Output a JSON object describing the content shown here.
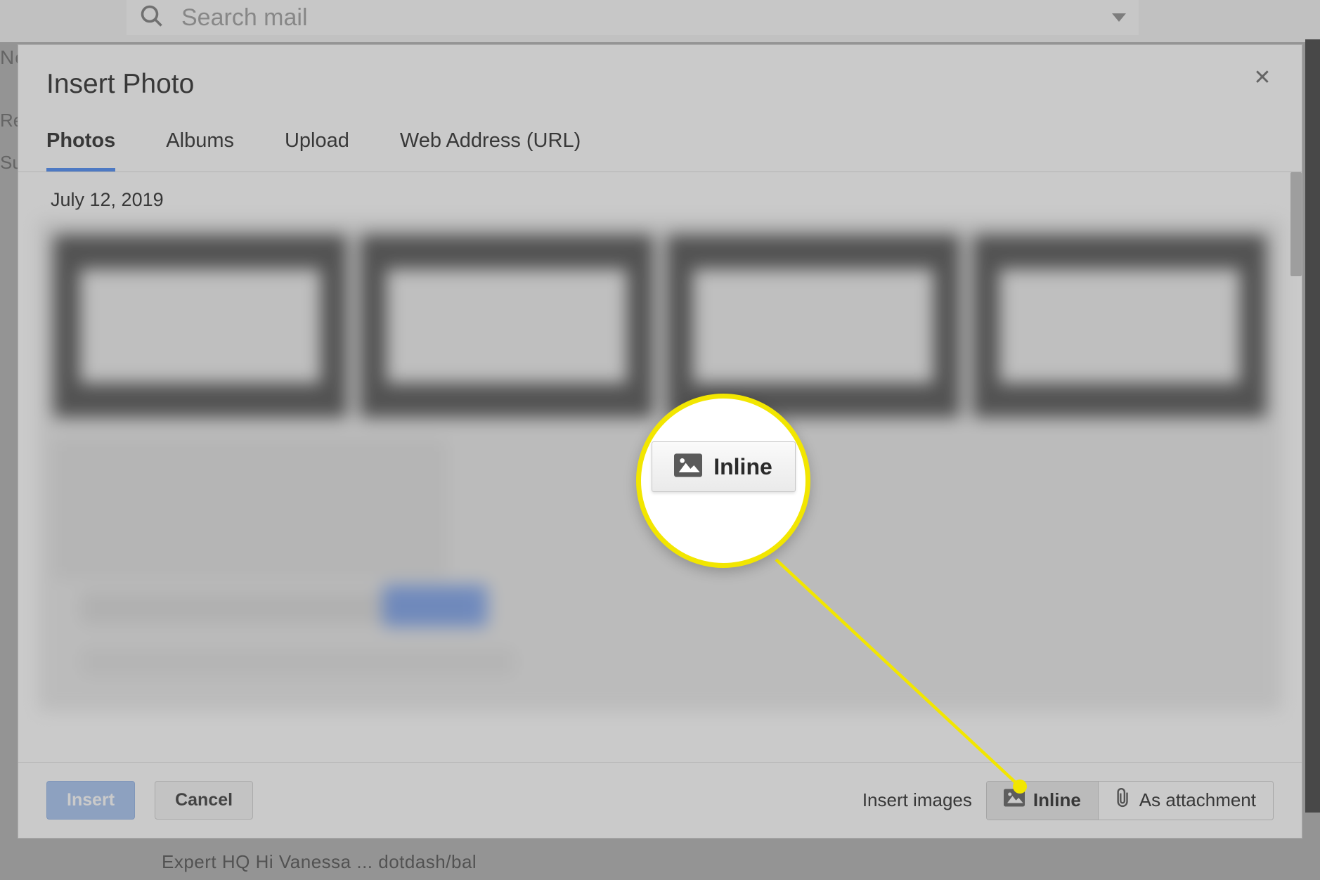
{
  "background": {
    "search_placeholder": "Search mail",
    "fragment_ne": "Ne",
    "fragment_re": "Re",
    "fragment_su": "Su",
    "bottom_caption": "Expert HQ Hi Vanessa ...    dotdash/bal"
  },
  "dialog": {
    "title": "Insert Photo",
    "tabs": {
      "photos": "Photos",
      "albums": "Albums",
      "upload": "Upload",
      "web": "Web Address (URL)"
    },
    "date": "July 12, 2019",
    "footer": {
      "insert": "Insert",
      "cancel": "Cancel",
      "insert_images_label": "Insert images",
      "inline": "Inline",
      "as_attachment": "As attachment"
    }
  },
  "callout": {
    "label": "Inline"
  }
}
